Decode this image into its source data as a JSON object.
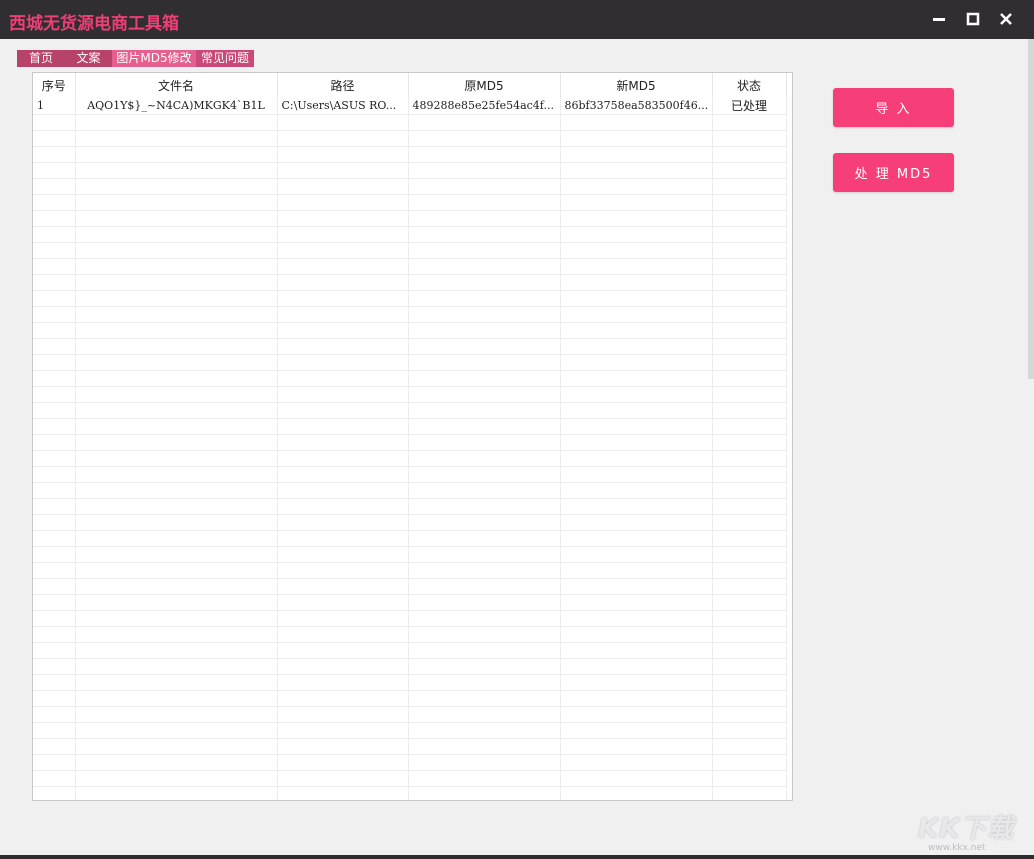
{
  "window": {
    "title": "西城无货源电商工具箱"
  },
  "tabs": [
    {
      "label": "首页"
    },
    {
      "label": "文案"
    },
    {
      "label": "图片MD5修改"
    },
    {
      "label": "常见问题"
    }
  ],
  "table": {
    "columns": [
      "序号",
      "文件名",
      "路径",
      "原MD5",
      "新MD5",
      "状态"
    ],
    "rows": [
      [
        "1",
        "AQO1Y$}_~N4CA)MKGK4`B1L",
        "C:\\Users\\ASUS RO...",
        "489288e85e25fe54ac4f...",
        "86bf33758ea583500f46...",
        "已处理"
      ]
    ]
  },
  "actions": {
    "import_label": "导 入",
    "process_label": "处 理 MD5"
  },
  "watermark": {
    "logo": "KK下载",
    "url": "www.kkx.net"
  },
  "colors": {
    "titlebar": "#302e33",
    "title_text": "#ec3f74",
    "accent": "#f63f78",
    "tab_active": "#e5608f"
  }
}
